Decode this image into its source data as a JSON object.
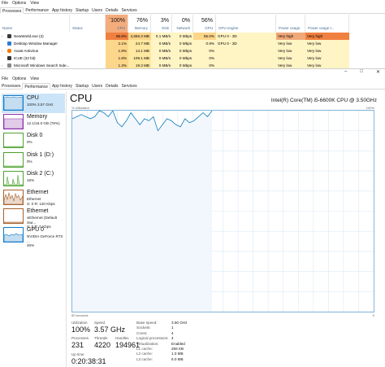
{
  "top": {
    "menu": [
      "File",
      "Options",
      "View"
    ],
    "tabs": [
      "Processes",
      "Performance",
      "App history",
      "Startup",
      "Users",
      "Details",
      "Services"
    ],
    "active_tab": 0,
    "headers": {
      "name": "Name",
      "status": "Status",
      "cpu_pct": "100%",
      "cpu": "CPU",
      "mem_pct": "76%",
      "mem": "Memory",
      "disk_pct": "3%",
      "disk": "Disk",
      "net_pct": "0%",
      "net": "Network",
      "gpu_pct": "56%",
      "gpu": "GPU",
      "gpu_engine": "GPU engine",
      "power": "Power usage",
      "power_trend": "Power usage t..."
    },
    "rows": [
      {
        "name": "NewWorld.exe (2)",
        "cpu": "85.6%",
        "mem": "4,656.3 MB",
        "disk": "0.1 MB/s",
        "net": "0 Mbps",
        "gpu": "55.0%",
        "engine": "GPU 0 - 3D",
        "power": "Very high",
        "trend": "Very high",
        "expand": true,
        "icon": "game-icon"
      },
      {
        "name": "Desktop Window Manager",
        "cpu": "2.1%",
        "mem": "24.7 MB",
        "disk": "0 MB/s",
        "net": "0 Mbps",
        "gpu": "0.9%",
        "engine": "GPU 0 - 3D",
        "power": "Very low",
        "trend": "Very low",
        "expand": false,
        "icon": "window-icon"
      },
      {
        "name": "Avast Antivirus",
        "cpu": "1.8%",
        "mem": "14.1 MB",
        "disk": "0 MB/s",
        "net": "0 Mbps",
        "gpu": "0%",
        "engine": "",
        "power": "Very low",
        "trend": "Very low",
        "expand": true,
        "icon": "shield-icon"
      },
      {
        "name": "ICUE (32 bit)",
        "cpu": "1.6%",
        "mem": "109.1 MB",
        "disk": "0 MB/s",
        "net": "0 Mbps",
        "gpu": "0%",
        "engine": "",
        "power": "Very low",
        "trend": "Very low",
        "expand": false,
        "icon": "gear-icon"
      },
      {
        "name": "Microsoft Windows Search Inde...",
        "cpu": "1.3%",
        "mem": "19.3 MB",
        "disk": "0 MB/s",
        "net": "0 Mbps",
        "gpu": "0%",
        "engine": "",
        "power": "Very low",
        "trend": "Very low",
        "expand": true,
        "icon": "search-icon"
      }
    ]
  },
  "main": {
    "window_buttons": [
      "–",
      "□",
      "✕"
    ],
    "menu": [
      "File",
      "Options",
      "View"
    ],
    "tabs": [
      "Processes",
      "Performance",
      "App history",
      "Startup",
      "Users",
      "Details",
      "Services"
    ],
    "active_tab": 1,
    "sidebar": [
      {
        "title": "CPU",
        "sub": "100% 3.57 GHz",
        "active": true
      },
      {
        "title": "Memory",
        "sub": "12.1/16.0 GB (76%)",
        "active": false
      },
      {
        "title": "Disk 0",
        "sub": "0%",
        "active": false
      },
      {
        "title": "Disk 1 (D:)",
        "sub": "0%",
        "active": false
      },
      {
        "title": "Disk 2 (C:)",
        "sub": "16%",
        "active": false
      },
      {
        "title": "Ethernet",
        "sub": "Ethernet\nS: 0 R: 120 Kbps",
        "active": false
      },
      {
        "title": "Ethernet",
        "sub": "vEthernet (Default Swi...\nS: 0 R: 0 Kbps",
        "active": false
      },
      {
        "title": "GPU 0",
        "sub": "NVIDIA GeForce RTX ...\n46%",
        "active": false
      }
    ],
    "content": {
      "title": "CPU",
      "cpu_name": "Intel(R) Core(TM) i5-6600K CPU @ 3.50GHz",
      "util_label": "% Utilization",
      "graph_max": "100%",
      "graph_time": "60 seconds",
      "graph_min": "0",
      "stats": {
        "utilization_label": "Utilization",
        "utilization": "100%",
        "speed_label": "Speed",
        "speed": "3.57 GHz",
        "processes_label": "Processes",
        "processes": "231",
        "threads_label": "Threads",
        "threads": "4220",
        "handles_label": "Handles",
        "handles": "194961",
        "uptime_label": "Up time",
        "uptime": "0:20:38:31"
      },
      "specs": [
        {
          "k": "Base speed:",
          "v": "3.50 GHz"
        },
        {
          "k": "Sockets:",
          "v": "1"
        },
        {
          "k": "Cores:",
          "v": "4"
        },
        {
          "k": "Logical processors:",
          "v": "4"
        },
        {
          "k": "Virtualization:",
          "v": "Enabled"
        },
        {
          "k": "L1 cache:",
          "v": "256 KB"
        },
        {
          "k": "L2 cache:",
          "v": "1.0 MB"
        },
        {
          "k": "L3 cache:",
          "v": "6.0 MB"
        }
      ],
      "graph_series": [
        96,
        97,
        98,
        97,
        96,
        97,
        100,
        99,
        97,
        100,
        94,
        92,
        95,
        99,
        96,
        93,
        96,
        95,
        97,
        90,
        93,
        96,
        95,
        93,
        92,
        96,
        94,
        95,
        97,
        99,
        97,
        100
      ]
    }
  }
}
